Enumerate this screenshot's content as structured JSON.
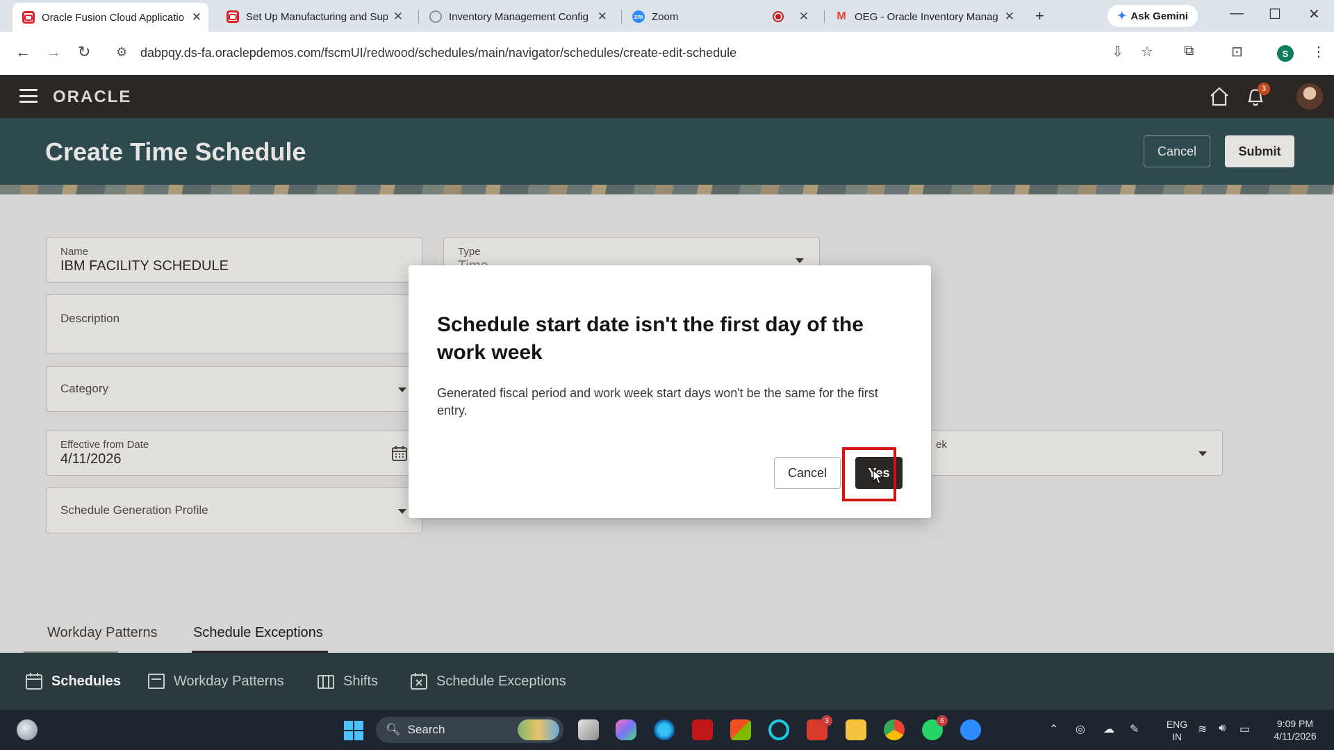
{
  "browser": {
    "tabs": [
      {
        "title": "Oracle Fusion Cloud Applicatio",
        "favicon": "oracle-icon",
        "active": true
      },
      {
        "title": "Set Up Manufacturing and Sup",
        "favicon": "oracle-icon",
        "active": false
      },
      {
        "title": "Inventory Management Config",
        "favicon": "globe-icon",
        "active": false
      },
      {
        "title": "Zoom",
        "favicon": "zoom-icon",
        "active": false
      },
      {
        "title": "OEG - Oracle Inventory Manag",
        "favicon": "gmail-icon",
        "active": false
      }
    ],
    "gemini_label": "Ask Gemini",
    "url": "dabpqy.ds-fa.oraclepdemos.com/fscmUI/redwood/schedules/main/navigator/schedules/create-edit-schedule",
    "profile_initial": "S"
  },
  "app": {
    "logo": "ORACLE",
    "notification_count": "3",
    "page_title": "Create Time Schedule",
    "header_buttons": {
      "cancel": "Cancel",
      "submit": "Submit"
    }
  },
  "form": {
    "name": {
      "label": "Name",
      "value": "IBM FACILITY SCHEDULE"
    },
    "type": {
      "label": "Type",
      "value": "Time"
    },
    "description": {
      "label": "Description"
    },
    "category": {
      "label": "Category"
    },
    "effective_from": {
      "label": "Effective from Date",
      "value": "4/11/2026"
    },
    "partial_label": "ek",
    "generation_profile": {
      "label": "Schedule Generation Profile"
    }
  },
  "content_tabs": [
    {
      "label": "Workday Patterns"
    },
    {
      "label": "Schedule Exceptions",
      "selected": true
    }
  ],
  "bottom_nav": [
    {
      "label": "Schedules",
      "icon": "calendar-icon",
      "selected": true
    },
    {
      "label": "Workday Patterns",
      "icon": "pattern-icon"
    },
    {
      "label": "Shifts",
      "icon": "shifts-icon"
    },
    {
      "label": "Schedule Exceptions",
      "icon": "exception-calendar-icon"
    }
  ],
  "dialog": {
    "title": "Schedule start date isn't the first day of the work week",
    "message": "Generated fiscal period and work week start days won't be the same for the first entry.",
    "cancel": "Cancel",
    "confirm": "Yes"
  },
  "taskbar": {
    "search_placeholder": "Search",
    "mail_badge": "3",
    "whatsapp_badge": "6",
    "language": "ENG",
    "region": "IN",
    "time": "9:09 PM",
    "date": "4/11/2026"
  },
  "colors": {
    "header_bg": "#2a2725",
    "title_band_bg": "#2f4a4e",
    "highlight": "#d11313",
    "primary_button": "#2a2725"
  }
}
